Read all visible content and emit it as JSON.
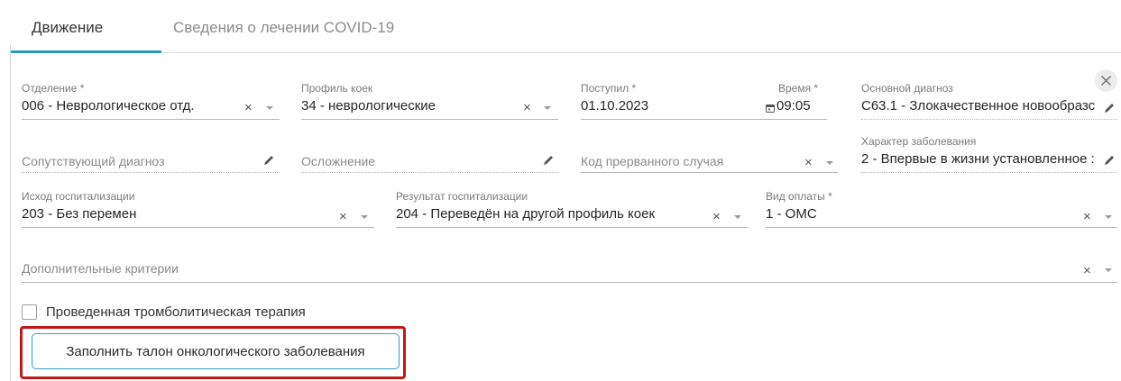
{
  "tabs": [
    {
      "label": "Движение"
    },
    {
      "label": "Сведения о лечении COVID-19"
    }
  ],
  "fields": {
    "department": {
      "label": "Отделение *",
      "value": "006 - Неврологическое отд."
    },
    "bed_profile": {
      "label": "Профиль коек",
      "value": "34 - неврологические"
    },
    "admitted": {
      "label": "Поступил *",
      "value": "01.10.2023"
    },
    "time": {
      "label": "Время *",
      "value": "09:05"
    },
    "main_diagnosis": {
      "label": "Основной диагноз",
      "value": "C63.1 - Злокачественное новообразс"
    },
    "comorbid_diagnosis": {
      "placeholder": "Сопутствующий диагноз"
    },
    "complication": {
      "placeholder": "Осложнение"
    },
    "interrupted_case_code": {
      "placeholder": "Код прерванного случая"
    },
    "disease_character": {
      "label": "Характер заболевания",
      "value": "2 - Впервые в жизни установленное :"
    },
    "hospitalization_outcome": {
      "label": "Исход госпитализации",
      "value": "203 - Без перемен"
    },
    "hospitalization_result": {
      "label": "Результат госпитализации",
      "value": "204 - Переведён на другой профиль коек"
    },
    "payment_type": {
      "label": "Вид оплаты *",
      "value": "1 - ОМС"
    },
    "additional_criteria": {
      "placeholder": "Дополнительные критерии"
    }
  },
  "thrombolytic_checkbox": {
    "label": "Проведенная тромболитическая терапия",
    "checked": false
  },
  "oncology_button": {
    "label": "Заполнить талон онкологического заболевания"
  },
  "icons": {
    "clear": "×",
    "dropdown": "chevron-down-icon",
    "edit": "pencil-icon",
    "calendar": "calendar-icon",
    "close": "close-icon"
  },
  "colors": {
    "accent": "#2a96c8",
    "highlight": "#c01818"
  }
}
